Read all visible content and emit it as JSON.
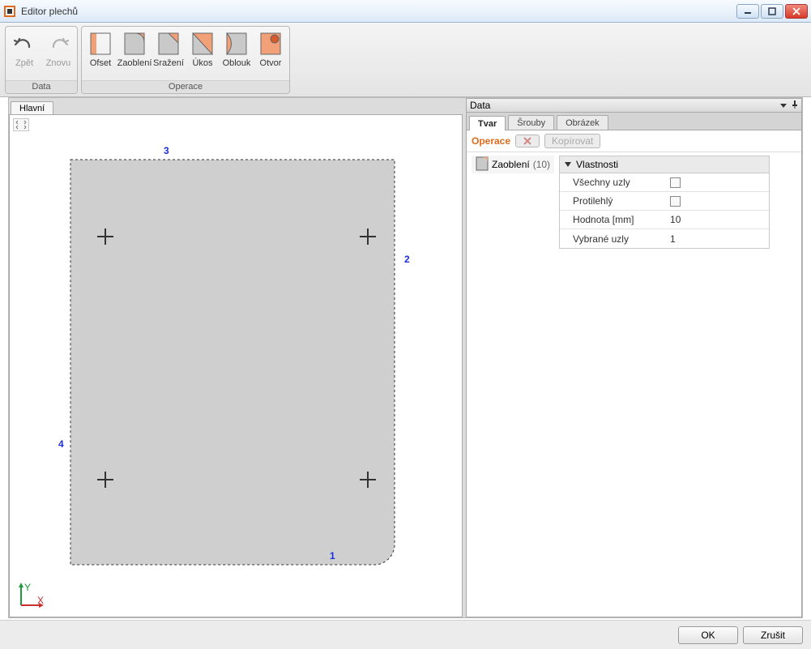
{
  "window": {
    "title": "Editor plechů"
  },
  "ribbon": {
    "groups": {
      "data": {
        "label": "Data",
        "items": {
          "undo": "Zpět",
          "redo": "Znovu"
        }
      },
      "ops": {
        "label": "Operace",
        "items": {
          "offset": "Ofset",
          "fillet": "Zaoblení",
          "chamfer": "Sražení",
          "bevel": "Úkos",
          "arc": "Oblouk",
          "hole": "Otvor"
        }
      }
    }
  },
  "left": {
    "tab": "Hlavní",
    "edge_labels": {
      "top": "3",
      "right": "2",
      "bottom": "1",
      "left": "4"
    },
    "axes": {
      "x": "X",
      "y": "Y"
    }
  },
  "right": {
    "panel_title": "Data",
    "subtabs": {
      "shape": "Tvar",
      "bolts": "Šrouby",
      "image": "Obrázek"
    },
    "operace_label": "Operace",
    "copy_btn": "Kopírovat",
    "op": {
      "name": "Zaoblení",
      "count": "(10)"
    },
    "properties": {
      "header": "Vlastnosti",
      "rows": {
        "all_nodes": {
          "label": "Všechny uzly",
          "value_kind": "checkbox"
        },
        "opposite": {
          "label": "Protilehlý",
          "value_kind": "checkbox"
        },
        "value": {
          "label": "Hodnota [mm]",
          "value": "10"
        },
        "selected": {
          "label": "Vybrané uzly",
          "value": "1"
        }
      }
    }
  },
  "buttons": {
    "ok": "OK",
    "cancel": "Zrušit"
  }
}
